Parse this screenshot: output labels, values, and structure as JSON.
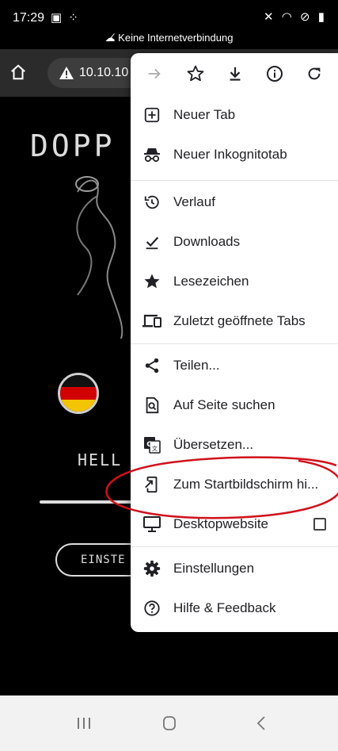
{
  "status": {
    "time": "17:29",
    "offline_text": "Keine Internetverbindung"
  },
  "browser": {
    "url": "10.10.10"
  },
  "page": {
    "title": "DOPP",
    "greeting": "HELL",
    "settings_button": "EINSTE"
  },
  "menu": {
    "items": [
      {
        "label": "Neuer Tab",
        "icon": "new-tab-icon"
      },
      {
        "label": "Neuer Inkognitotab",
        "icon": "incognito-icon"
      },
      {
        "label": "Verlauf",
        "icon": "history-icon"
      },
      {
        "label": "Downloads",
        "icon": "downloads-icon"
      },
      {
        "label": "Lesezeichen",
        "icon": "bookmarks-star-icon"
      },
      {
        "label": "Zuletzt geöffnete Tabs",
        "icon": "recent-tabs-icon"
      },
      {
        "label": "Teilen...",
        "icon": "share-icon"
      },
      {
        "label": "Auf Seite suchen",
        "icon": "find-in-page-icon"
      },
      {
        "label": "Übersetzen...",
        "icon": "translate-icon"
      },
      {
        "label": "Zum Startbildschirm hi...",
        "icon": "add-to-home-icon"
      },
      {
        "label": "Desktopwebsite",
        "icon": "desktop-icon"
      },
      {
        "label": "Einstellungen",
        "icon": "gear-icon"
      },
      {
        "label": "Hilfe & Feedback",
        "icon": "help-icon"
      }
    ],
    "desktop_checked": false
  },
  "colors": {
    "annotation": "#d0111b",
    "menu_bg": "#ffffff",
    "toolbar_bg": "#2b2b2b"
  }
}
